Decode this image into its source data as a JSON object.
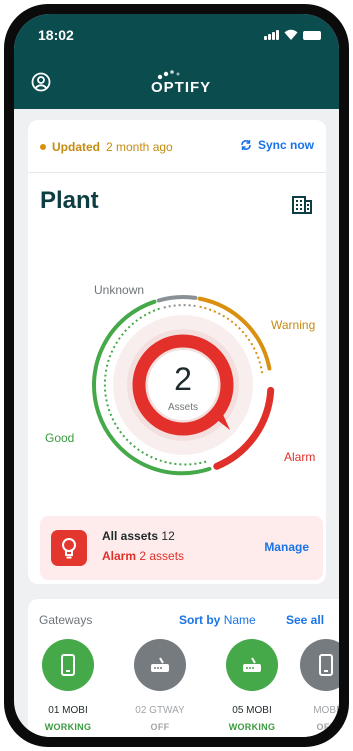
{
  "status_bar": {
    "time": "18:02"
  },
  "header": {
    "logo_text": "OPTIFY"
  },
  "update_bar": {
    "updated_label": "Updated",
    "updated_ago": "2 month ago",
    "sync_label": "Sync now"
  },
  "plant": {
    "title": "Plant"
  },
  "summary_chart": {
    "center_value": "2",
    "center_label": "Assets",
    "segments": [
      {
        "label": "Unknown",
        "color": "#8a9196"
      },
      {
        "label": "Warning",
        "color": "#d9900f"
      },
      {
        "label": "Alarm",
        "color": "#e0302a"
      },
      {
        "label": "Good",
        "color": "#45a849"
      }
    ]
  },
  "alarm_summary": {
    "all_assets_label": "All assets",
    "all_assets_count": "12",
    "alarm_label": "Alarm",
    "alarm_count_text": "2 assets",
    "manage_label": "Manage"
  },
  "gateways": {
    "title": "Gateways",
    "sort_prefix": "Sort by",
    "sort_value": "Name",
    "see_all_label": "See all",
    "items": [
      {
        "name": "01 MOBI",
        "status": "WORKING",
        "icon": "phone-icon",
        "color": "#45a849",
        "name_color": "#1f2a2c",
        "status_color": "#3a9b3f"
      },
      {
        "name": "02 GTWAY",
        "status": "OFF",
        "icon": "router-icon",
        "color": "#767b80",
        "name_color": "#a0a5a9",
        "status_color": "#a0a5a9"
      },
      {
        "name": "05 MOBI",
        "status": "WORKING",
        "icon": "router-icon",
        "color": "#45a849",
        "name_color": "#1f2a2c",
        "status_color": "#3a9b3f"
      },
      {
        "name": "MOBI",
        "status": "OFF",
        "icon": "phone-icon",
        "color": "#767b80",
        "name_color": "#a0a5a9",
        "status_color": "#a0a5a9"
      }
    ]
  }
}
